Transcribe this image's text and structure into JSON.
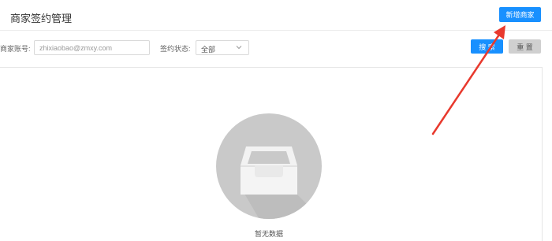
{
  "header": {
    "title": "商家签约管理",
    "add_button": "新增商家"
  },
  "filters": {
    "account_label": "商家账号:",
    "account_placeholder": "zhixiaobao@zmxy.com",
    "status_label": "签约状态:",
    "status_value": "全部",
    "search_button": "搜 索",
    "reset_button": "重 置"
  },
  "empty": {
    "icon": "inbox-icon",
    "text": "暂无数据"
  },
  "colors": {
    "primary": "#1890ff",
    "annotation_arrow": "#e8392d",
    "empty_circle": "#c9c9c9"
  }
}
